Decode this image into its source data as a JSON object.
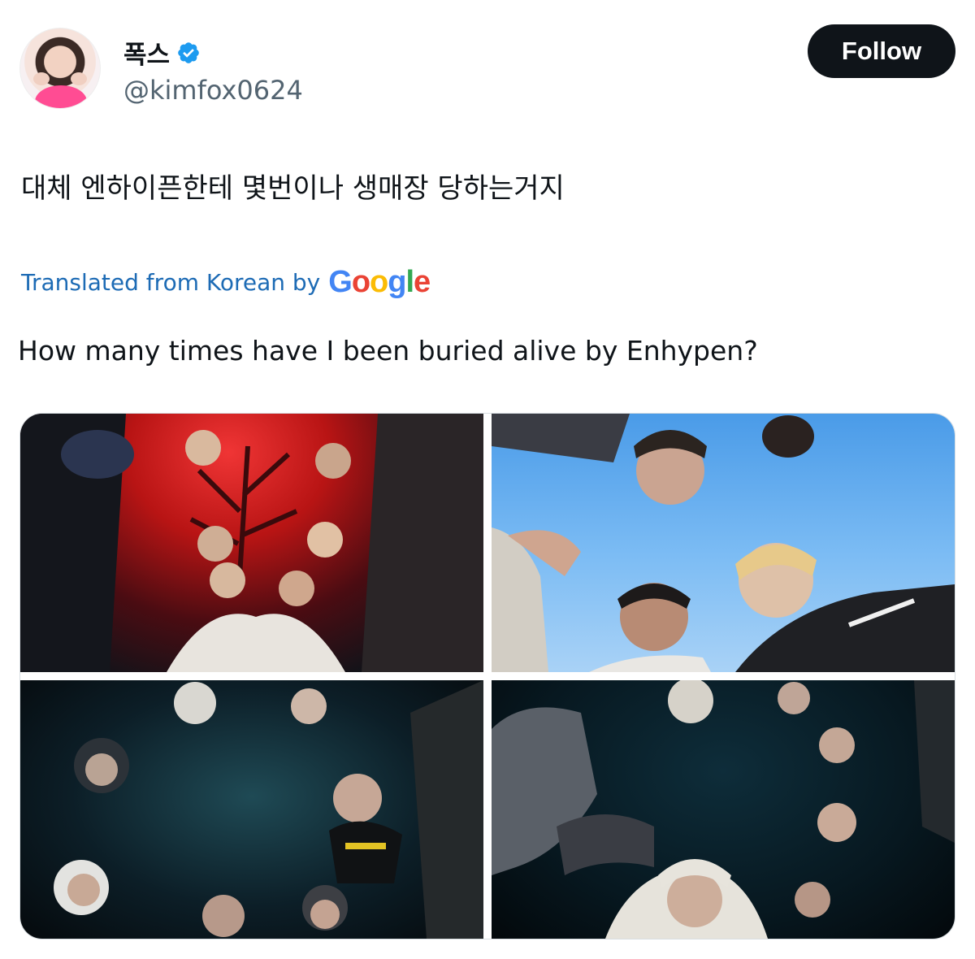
{
  "author": {
    "display_name": "폭스",
    "handle": "@kimfox0624",
    "verified": true
  },
  "actions": {
    "follow_label": "Follow"
  },
  "tweet": {
    "text_original": "대체 엔하이픈한테 몇번이나 생매장 당하는거지",
    "translated_label": "Translated from Korean by",
    "translator_logo": "Google",
    "text_translated": "How many times have I been buried alive by Enhypen?"
  },
  "media": {
    "count": 4,
    "photos": [
      {
        "icon": "group-photo-red-forest"
      },
      {
        "icon": "group-photo-blue-sky"
      },
      {
        "icon": "group-photo-dark-teal"
      },
      {
        "icon": "group-photo-dark-navy"
      }
    ]
  },
  "colors": {
    "follow_bg": "#0f1419",
    "verified": "#1d9bf0",
    "translated_link": "#1d6bb5"
  }
}
